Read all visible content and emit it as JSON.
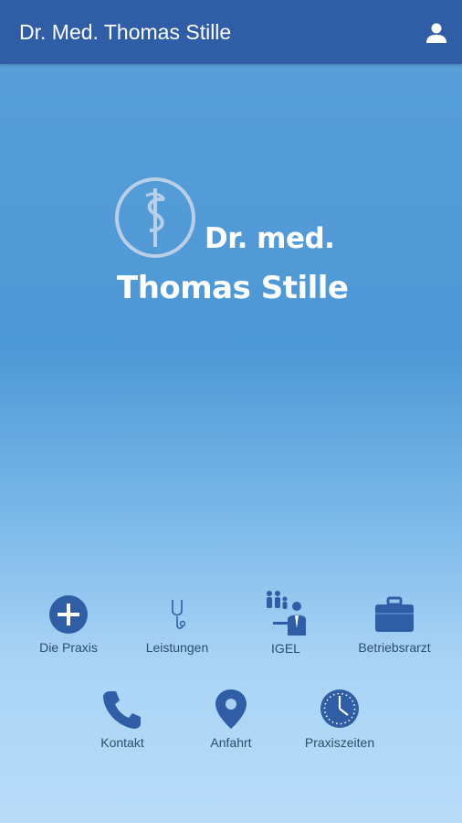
{
  "header": {
    "title": "Dr. Med. Thomas Stille",
    "user_icon": "user-icon"
  },
  "logo": {
    "line1": "Dr. med.",
    "line2": "Thomas Stille",
    "mark_icon": "aesculapius-staff-icon"
  },
  "nav": {
    "items": [
      {
        "label": "Die Praxis",
        "icon": "plus-circle-icon"
      },
      {
        "label": "Leistungen",
        "icon": "stethoscope-icon"
      },
      {
        "label": "IGEL",
        "icon": "doctor-family-icon"
      },
      {
        "label": "Betriebsrarzt",
        "icon": "briefcase-icon"
      },
      {
        "label": "Kontakt",
        "icon": "phone-icon"
      },
      {
        "label": "Anfahrt",
        "icon": "map-pin-icon"
      },
      {
        "label": "Praxiszeiten",
        "icon": "clock-icon"
      }
    ]
  },
  "colors": {
    "header": "#2f5ea6",
    "icon": "#2f5ea6",
    "label": "#2c4d70"
  }
}
